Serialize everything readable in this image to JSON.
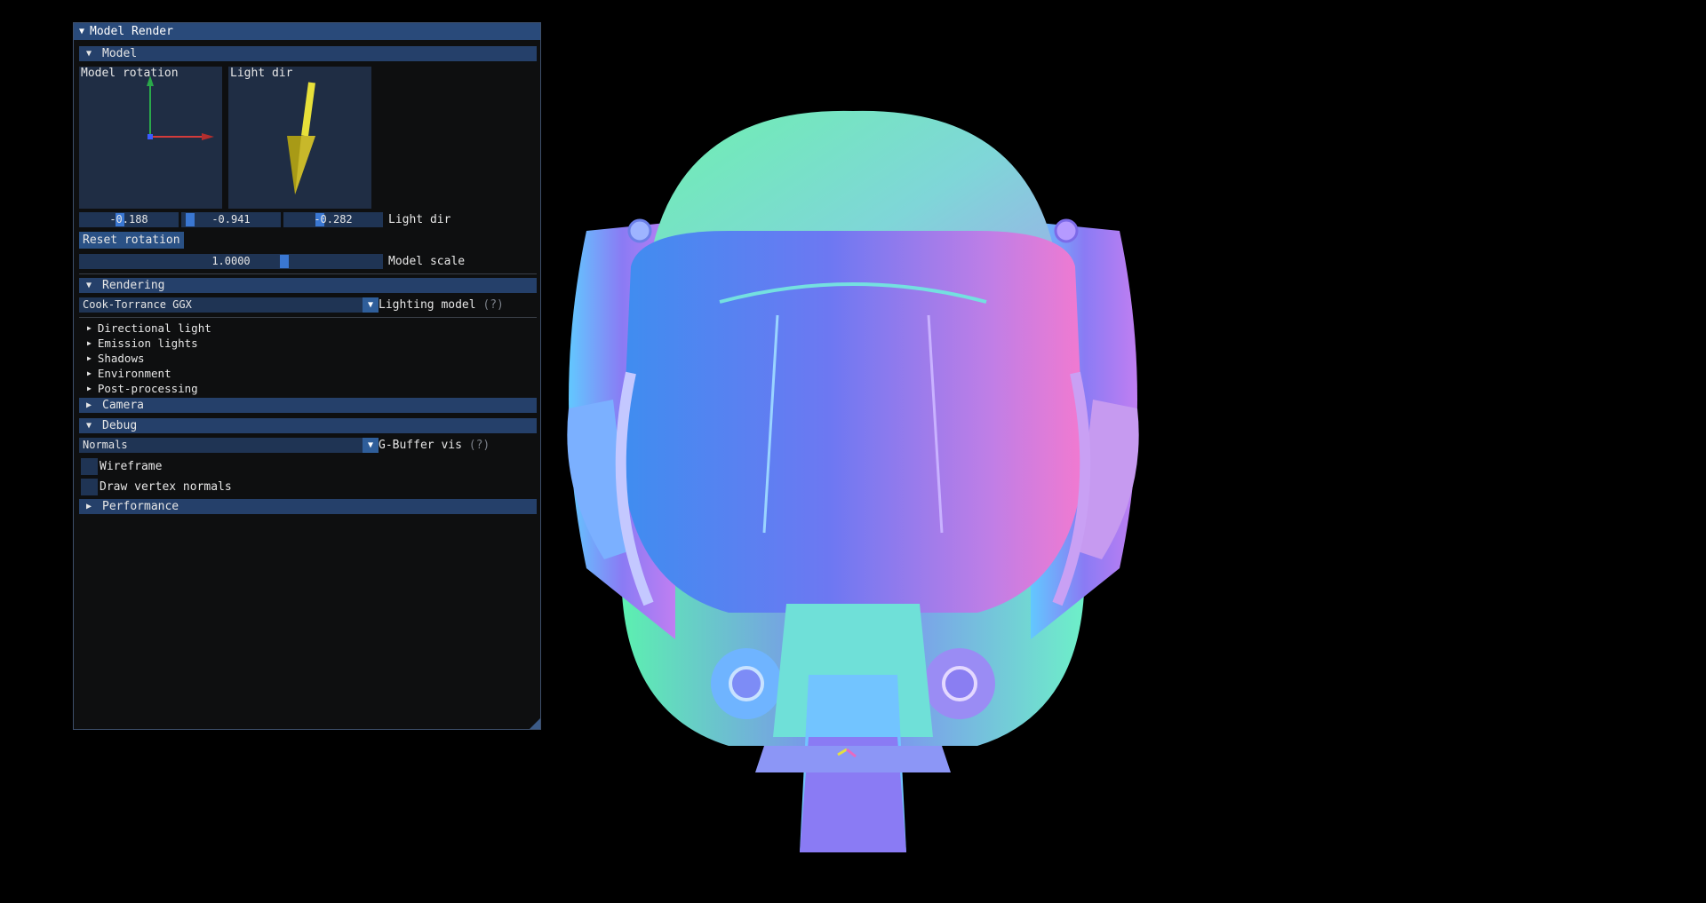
{
  "window": {
    "title": "Model Render"
  },
  "model": {
    "header": "Model",
    "gizmo_rotation_label": "Model rotation",
    "gizmo_light_label": "Light dir",
    "light_dir_values": [
      "-0.188",
      "-0.941",
      "-0.282"
    ],
    "light_dir_label": "Light dir",
    "reset_label": "Reset rotation",
    "scale_value": "1.0000",
    "scale_label": "Model scale"
  },
  "rendering": {
    "header": "Rendering",
    "lighting_model_value": "Cook-Torrance GGX",
    "lighting_model_label": "Lighting model",
    "help": "(?)",
    "nodes": [
      "Directional light",
      "Emission lights",
      "Shadows",
      "Environment",
      "Post-processing"
    ]
  },
  "camera": {
    "header": "Camera"
  },
  "debug": {
    "header": "Debug",
    "gbuffer_value": "Normals",
    "gbuffer_label": "G-Buffer vis",
    "help": "(?)",
    "wireframe_label": "Wireframe",
    "vertex_normals_label": "Draw vertex normals"
  },
  "performance": {
    "header": "Performance"
  },
  "colors": {
    "accent": "#3d7ee0",
    "header": "#25406a",
    "title": "#294a7a"
  }
}
